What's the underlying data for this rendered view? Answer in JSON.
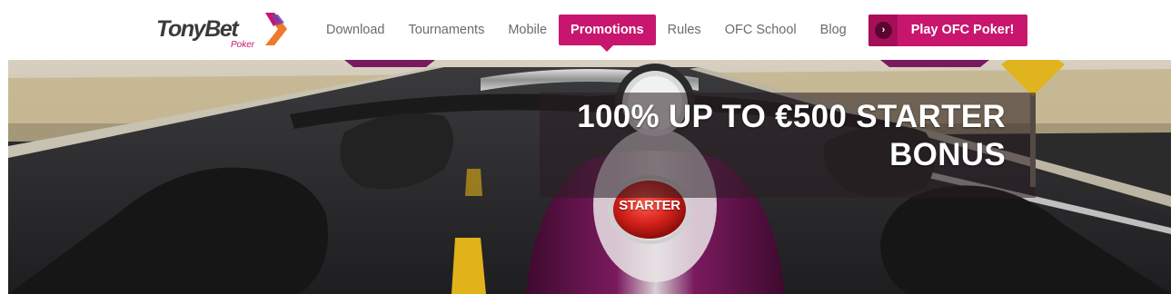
{
  "brand": {
    "name": "TonyBet",
    "sub": "Poker",
    "accent": "#c8166e"
  },
  "nav": {
    "items": [
      {
        "label": "Download",
        "active": false
      },
      {
        "label": "Tournaments",
        "active": false
      },
      {
        "label": "Mobile",
        "active": false
      },
      {
        "label": "Promotions",
        "active": true
      },
      {
        "label": "Rules",
        "active": false
      },
      {
        "label": "OFC School",
        "active": false
      },
      {
        "label": "Blog",
        "active": false
      }
    ]
  },
  "cta": {
    "icon": "chevron-right-icon",
    "label": "Play OFC Poker!"
  },
  "hero": {
    "headline_line1": "100% UP TO €500 STARTER",
    "headline_line2": "BONUS",
    "starter_button_text": "STARTER"
  }
}
